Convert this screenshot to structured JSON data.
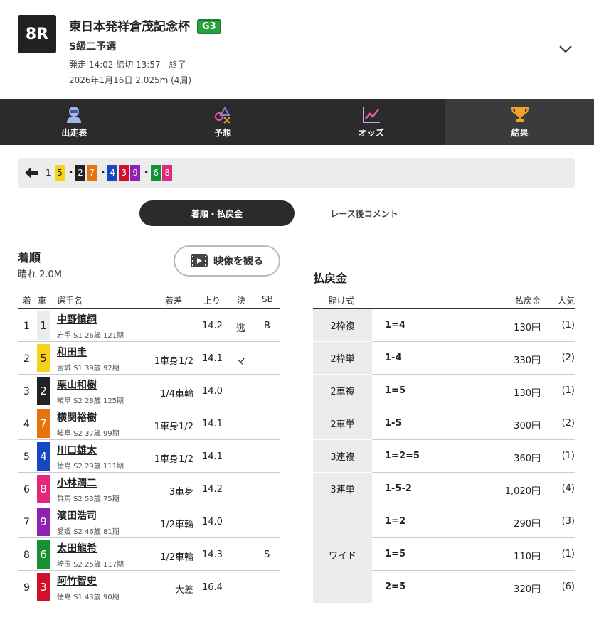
{
  "race": {
    "number": "8R",
    "title": "東日本発祥倉茂記念杯",
    "grade": "G3",
    "subtitle": "S級二予選",
    "time_info": "発走 14:02 締切 13:57　終了",
    "date_info": "2026年1月16日 2,025m (4周)"
  },
  "tabs": [
    {
      "label": "出走表",
      "icon": "racer-icon"
    },
    {
      "label": "予想",
      "icon": "prediction-icon"
    },
    {
      "label": "オッズ",
      "icon": "chart-icon"
    },
    {
      "label": "結果",
      "icon": "trophy-icon",
      "active": true
    }
  ],
  "strip": {
    "chips": [
      {
        "n": "1",
        "bg": "#ececec",
        "fg": "#222"
      },
      {
        "n": "5",
        "bg": "#f6d21b",
        "fg": "#222"
      },
      {
        "n": "2",
        "bg": "#222222",
        "fg": "#fff"
      },
      {
        "n": "7",
        "bg": "#e8730c",
        "fg": "#fff"
      },
      {
        "n": "4",
        "bg": "#1747c1",
        "fg": "#fff"
      },
      {
        "n": "3",
        "bg": "#d0112b",
        "fg": "#fff"
      },
      {
        "n": "9",
        "bg": "#8e22b1",
        "fg": "#fff"
      },
      {
        "n": "6",
        "bg": "#16912f",
        "fg": "#fff"
      },
      {
        "n": "8",
        "bg": "#e2287b",
        "fg": "#fff"
      }
    ]
  },
  "toggle": {
    "active": "着順・払戻金",
    "inactive": "レース後コメント"
  },
  "results": {
    "title": "着順",
    "weather": "晴れ  2.0M",
    "video_label": "映像を観る",
    "headers": [
      "着",
      "車",
      "選手名",
      "着差",
      "上り",
      "決",
      "SB"
    ],
    "rows": [
      {
        "pos": "1",
        "num": "1",
        "bg": "#ececec",
        "fg": "#222",
        "name": "中野慎詞",
        "info": "岩手 S1 26歳 121期",
        "diff": "",
        "last": "14.2",
        "win": "逃",
        "sb": "B"
      },
      {
        "pos": "2",
        "num": "5",
        "bg": "#f6d21b",
        "fg": "#222",
        "name": "和田圭",
        "info": "宮城 S1 39歳 92期",
        "diff": "1車身1/2",
        "last": "14.1",
        "win": "マ",
        "sb": ""
      },
      {
        "pos": "3",
        "num": "2",
        "bg": "#222222",
        "fg": "#fff",
        "name": "栗山和樹",
        "info": "岐阜 S2 28歳 125期",
        "diff": "1/4車輪",
        "last": "14.0",
        "win": "",
        "sb": ""
      },
      {
        "pos": "4",
        "num": "7",
        "bg": "#e8730c",
        "fg": "#fff",
        "name": "横関裕樹",
        "info": "岐阜 S2 37歳 99期",
        "diff": "1車身1/2",
        "last": "14.1",
        "win": "",
        "sb": ""
      },
      {
        "pos": "5",
        "num": "4",
        "bg": "#1747c1",
        "fg": "#fff",
        "name": "川口雄太",
        "info": "徳島 S2 29歳 111期",
        "diff": "1車身1/2",
        "last": "14.1",
        "win": "",
        "sb": ""
      },
      {
        "pos": "6",
        "num": "8",
        "bg": "#e2287b",
        "fg": "#fff",
        "name": "小林潤二",
        "info": "群馬 S2 53歳 75期",
        "diff": "3車身",
        "last": "14.2",
        "win": "",
        "sb": ""
      },
      {
        "pos": "7",
        "num": "9",
        "bg": "#8e22b1",
        "fg": "#fff",
        "name": "濱田浩司",
        "info": "愛媛 S2 46歳 81期",
        "diff": "1/2車輪",
        "last": "14.0",
        "win": "",
        "sb": ""
      },
      {
        "pos": "8",
        "num": "6",
        "bg": "#16912f",
        "fg": "#fff",
        "name": "太田龍希",
        "info": "埼玉 S2 25歳 117期",
        "diff": "1/2車輪",
        "last": "14.3",
        "win": "",
        "sb": "S"
      },
      {
        "pos": "9",
        "num": "3",
        "bg": "#d0112b",
        "fg": "#fff",
        "name": "阿竹智史",
        "info": "徳島 S1 43歳 90期",
        "diff": "大差",
        "last": "16.4",
        "win": "",
        "sb": ""
      }
    ]
  },
  "payouts": {
    "title": "払戻金",
    "headers": [
      "賭け式",
      "払戻金",
      "人気"
    ],
    "rows": [
      {
        "type": "2枠複",
        "combo": "1=4",
        "amount": "130円",
        "pop": "(1)"
      },
      {
        "type": "2枠単",
        "combo": "1-4",
        "amount": "330円",
        "pop": "(2)"
      },
      {
        "type": "2車複",
        "combo": "1=5",
        "amount": "130円",
        "pop": "(1)"
      },
      {
        "type": "2車単",
        "combo": "1-5",
        "amount": "300円",
        "pop": "(2)"
      },
      {
        "type": "3連複",
        "combo": "1=2=5",
        "amount": "360円",
        "pop": "(1)"
      },
      {
        "type": "3連単",
        "combo": "1-5-2",
        "amount": "1,020円",
        "pop": "(4)"
      }
    ],
    "wide": {
      "type": "ワイド",
      "rows": [
        {
          "combo": "1=2",
          "amount": "290円",
          "pop": "(3)"
        },
        {
          "combo": "1=5",
          "amount": "110円",
          "pop": "(1)"
        },
        {
          "combo": "2=5",
          "amount": "320円",
          "pop": "(6)"
        }
      ]
    }
  }
}
